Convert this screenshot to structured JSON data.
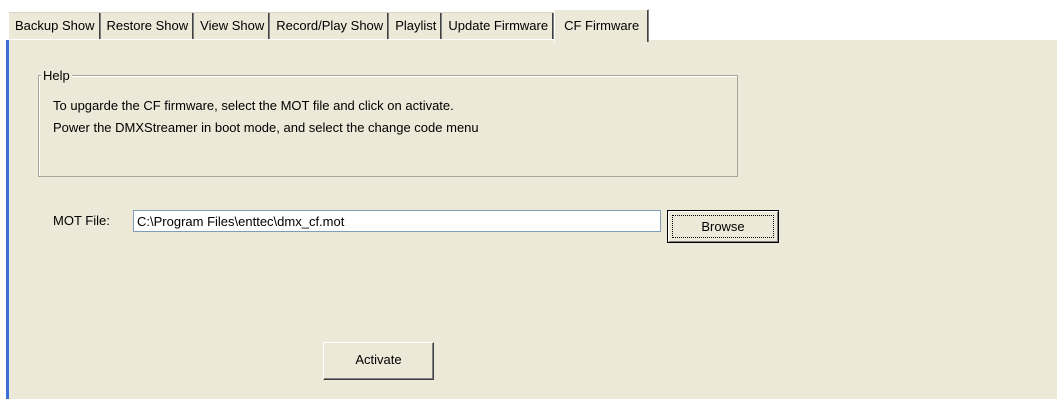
{
  "tabs": [
    {
      "label": "Backup Show",
      "active": false
    },
    {
      "label": "Restore Show",
      "active": false
    },
    {
      "label": "View Show",
      "active": false
    },
    {
      "label": "Record/Play Show",
      "active": false
    },
    {
      "label": "Playlist",
      "active": false
    },
    {
      "label": "Update Firmware",
      "active": false
    },
    {
      "label": "CF Firmware",
      "active": true
    }
  ],
  "help": {
    "title": "Help",
    "line1": "To upgarde the CF firmware, select the MOT file and click on activate.",
    "line2": "Power the DMXStreamer in boot mode, and select the change code menu"
  },
  "mot_file": {
    "label": "MOT File:",
    "value": "C:\\Program Files\\enttec\\dmx_cf.mot"
  },
  "buttons": {
    "browse": "Browse",
    "activate": "Activate"
  },
  "colors": {
    "panel": "#ece9d8",
    "accent_edge": "#3a6fd8"
  }
}
